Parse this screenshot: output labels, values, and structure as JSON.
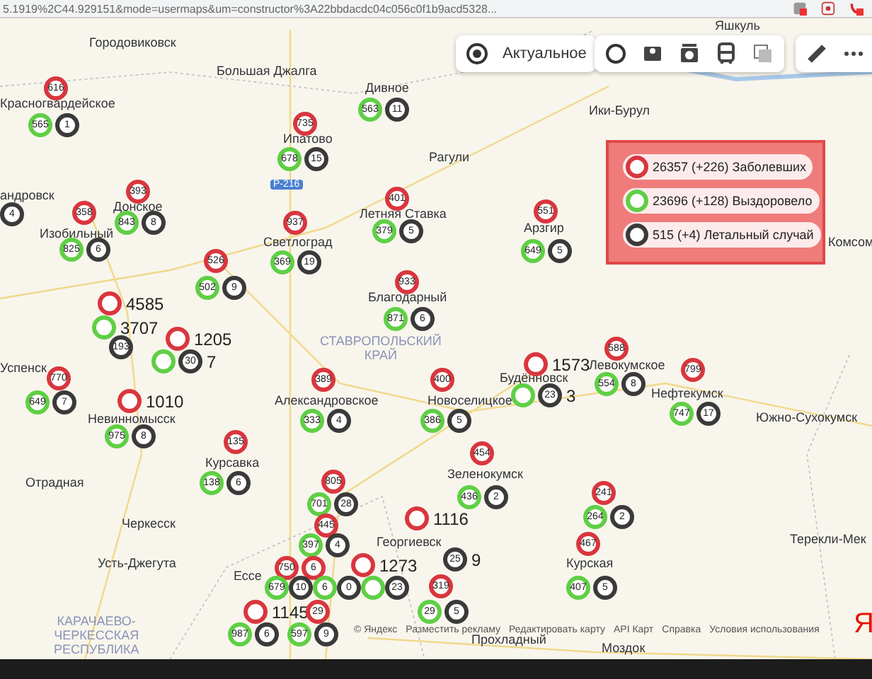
{
  "browser": {
    "url": "5.1919%2C44.929151&mode=usermaps&um=constructor%3A22bbdacdc04c056c0f1b9acd5328..."
  },
  "toolbar": {
    "layer_button": "Актуальное"
  },
  "legend": [
    {
      "kind": "infected",
      "text": "26357 (+226) Заболевших"
    },
    {
      "kind": "recovered",
      "text": "23696 (+128) Выздоровело"
    },
    {
      "kind": "deaths",
      "text": "515 (+4) Летальный случай"
    }
  ],
  "places": [
    {
      "kind": "town",
      "name": "Яшкуль"
    },
    {
      "kind": "town",
      "name": "Городовиковск"
    },
    {
      "kind": "town",
      "name": "Большая Джалга"
    },
    {
      "kind": "town",
      "name": "Красногвардейское"
    },
    {
      "kind": "town",
      "name": "Дивное"
    },
    {
      "kind": "town",
      "name": "Ипатово"
    },
    {
      "kind": "town",
      "name": "Ики-Бурул"
    },
    {
      "kind": "town",
      "name": "Рагули"
    },
    {
      "kind": "town",
      "name": "андровск"
    },
    {
      "kind": "town",
      "name": "Донское"
    },
    {
      "kind": "town",
      "name": "Летняя Ставка"
    },
    {
      "kind": "town",
      "name": "Изобильный"
    },
    {
      "kind": "town",
      "name": "Светлоград"
    },
    {
      "kind": "town",
      "name": "Арзгир"
    },
    {
      "kind": "town",
      "name": "Комсом"
    },
    {
      "kind": "town",
      "name": "Благодарный"
    },
    {
      "kind": "region",
      "name": "СТАВРОПОЛЬСКИЙ КРАЙ"
    },
    {
      "kind": "town",
      "name": "Успенск"
    },
    {
      "kind": "town",
      "name": "Будённовск"
    },
    {
      "kind": "town",
      "name": "Левокумское"
    },
    {
      "kind": "town",
      "name": "Нефтекумск"
    },
    {
      "kind": "town",
      "name": "Александровское"
    },
    {
      "kind": "town",
      "name": "Новоселицкое"
    },
    {
      "kind": "town",
      "name": "Невинномысск"
    },
    {
      "kind": "town",
      "name": "Южно-Сухокумск"
    },
    {
      "kind": "town",
      "name": "Курсавка"
    },
    {
      "kind": "town",
      "name": "Отрадная"
    },
    {
      "kind": "town",
      "name": "Зеленокумск"
    },
    {
      "kind": "town",
      "name": "Черкесск"
    },
    {
      "kind": "town",
      "name": "Георгиевск"
    },
    {
      "kind": "town",
      "name": "Терекли-Мек"
    },
    {
      "kind": "town",
      "name": "Усть-Джегута"
    },
    {
      "kind": "town",
      "name": "Курская"
    },
    {
      "kind": "town",
      "name": "Ессе"
    },
    {
      "kind": "region",
      "name": "КАРАЧАЕВО-ЧЕРКЕССКАЯ РЕСПУБЛИКА"
    },
    {
      "kind": "town",
      "name": "Прохладный"
    },
    {
      "kind": "town",
      "name": "Моздок"
    },
    {
      "kind": "road",
      "name": "Р-216"
    }
  ],
  "clusters": [
    {
      "markers": [
        {
          "kind": "infected",
          "value": "616"
        }
      ]
    },
    {
      "markers": [
        {
          "kind": "recovered",
          "value": "565"
        },
        {
          "kind": "deaths",
          "value": "1"
        }
      ]
    },
    {
      "markers": [
        {
          "kind": "infected",
          "value": "735"
        }
      ]
    },
    {
      "markers": [
        {
          "kind": "recovered",
          "value": "563"
        },
        {
          "kind": "deaths",
          "value": "11"
        }
      ]
    },
    {
      "markers": [
        {
          "kind": "recovered",
          "value": "678"
        },
        {
          "kind": "deaths",
          "value": "15"
        }
      ]
    },
    {
      "markers": [
        {
          "kind": "infected",
          "value": "393"
        }
      ]
    },
    {
      "markers": [
        {
          "kind": "infected",
          "value": "401"
        }
      ]
    },
    {
      "markers": [
        {
          "kind": "deaths",
          "value": "4"
        }
      ]
    },
    {
      "markers": [
        {
          "kind": "infected",
          "value": "358"
        }
      ]
    },
    {
      "markers": [
        {
          "kind": "recovered",
          "value": "843"
        },
        {
          "kind": "deaths",
          "value": "8"
        }
      ]
    },
    {
      "markers": [
        {
          "kind": "infected",
          "value": "937"
        }
      ]
    },
    {
      "markers": [
        {
          "kind": "recovered",
          "value": "379"
        },
        {
          "kind": "deaths",
          "value": "5"
        }
      ]
    },
    {
      "markers": [
        {
          "kind": "recovered",
          "value": "825"
        },
        {
          "kind": "deaths",
          "value": "6"
        }
      ]
    },
    {
      "markers": [
        {
          "kind": "infected",
          "value": "526"
        }
      ]
    },
    {
      "markers": [
        {
          "kind": "recovered",
          "value": "369"
        },
        {
          "kind": "deaths",
          "value": "19"
        }
      ]
    },
    {
      "markers": [
        {
          "kind": "recovered",
          "value": "502"
        },
        {
          "kind": "deaths",
          "value": "9"
        }
      ]
    },
    {
      "markers": [
        {
          "kind": "infected",
          "value": "933"
        }
      ]
    },
    {
      "markers": [
        {
          "kind": "recovered",
          "value": "871"
        },
        {
          "kind": "deaths",
          "value": "6"
        }
      ]
    },
    {
      "markers": [
        {
          "kind": "infected"
        }
      ],
      "label": "4585"
    },
    {
      "markers": [
        {
          "kind": "recovered"
        }
      ],
      "label": "3707"
    },
    {
      "markers": [
        {
          "kind": "deaths",
          "value": "193"
        }
      ]
    },
    {
      "markers": [
        {
          "kind": "infected"
        }
      ],
      "label": "1205"
    },
    {
      "markers": [
        {
          "kind": "recovered"
        },
        {
          "kind": "deaths",
          "value": "30"
        }
      ],
      "label": "7"
    },
    {
      "markers": [
        {
          "kind": "infected",
          "value": "770"
        }
      ]
    },
    {
      "markers": [
        {
          "kind": "recovered",
          "value": "649"
        },
        {
          "kind": "deaths",
          "value": "7"
        }
      ]
    },
    {
      "markers": [
        {
          "kind": "infected"
        }
      ],
      "label": "1010"
    },
    {
      "markers": [
        {
          "kind": "recovered",
          "value": "975"
        },
        {
          "kind": "deaths",
          "value": "8"
        }
      ]
    },
    {
      "markers": [
        {
          "kind": "infected",
          "value": "389"
        }
      ]
    },
    {
      "markers": [
        {
          "kind": "recovered",
          "value": "333"
        },
        {
          "kind": "deaths",
          "value": "4"
        }
      ]
    },
    {
      "markers": [
        {
          "kind": "infected",
          "value": "400"
        }
      ]
    },
    {
      "markers": [
        {
          "kind": "recovered",
          "value": "386"
        },
        {
          "kind": "deaths",
          "value": "5"
        }
      ]
    },
    {
      "markers": [
        {
          "kind": "infected",
          "value": "551"
        }
      ]
    },
    {
      "markers": [
        {
          "kind": "recovered",
          "value": "649"
        },
        {
          "kind": "deaths",
          "value": "5"
        }
      ]
    },
    {
      "markers": [
        {
          "kind": "infected"
        }
      ],
      "label": "1573"
    },
    {
      "markers": [
        {
          "kind": "recovered"
        },
        {
          "kind": "deaths",
          "value": "23"
        }
      ],
      "label": "3"
    },
    {
      "markers": [
        {
          "kind": "infected",
          "value": "588"
        }
      ]
    },
    {
      "markers": [
        {
          "kind": "recovered",
          "value": "554"
        },
        {
          "kind": "deaths",
          "value": "8"
        }
      ]
    },
    {
      "markers": [
        {
          "kind": "infected",
          "value": "799"
        }
      ]
    },
    {
      "markers": [
        {
          "kind": "recovered",
          "value": "747"
        },
        {
          "kind": "deaths",
          "value": "17"
        }
      ]
    },
    {
      "markers": [
        {
          "kind": "infected",
          "value": "135"
        }
      ]
    },
    {
      "markers": [
        {
          "kind": "recovered",
          "value": "138"
        },
        {
          "kind": "deaths",
          "value": "6"
        }
      ]
    },
    {
      "markers": [
        {
          "kind": "infected",
          "value": "805"
        }
      ]
    },
    {
      "markers": [
        {
          "kind": "recovered",
          "value": "701"
        },
        {
          "kind": "deaths",
          "value": "28"
        }
      ]
    },
    {
      "markers": [
        {
          "kind": "infected",
          "value": "454"
        }
      ]
    },
    {
      "markers": [
        {
          "kind": "recovered",
          "value": "436"
        },
        {
          "kind": "deaths",
          "value": "2"
        }
      ]
    },
    {
      "markers": [
        {
          "kind": "infected",
          "value": "445"
        }
      ]
    },
    {
      "markers": [
        {
          "kind": "recovered",
          "value": "397"
        },
        {
          "kind": "deaths",
          "value": "4"
        }
      ]
    },
    {
      "markers": [
        {
          "kind": "infected",
          "value": "750"
        },
        {
          "kind": "infected",
          "value": "6"
        }
      ]
    },
    {
      "markers": [
        {
          "kind": "infected"
        }
      ],
      "label": "1273"
    },
    {
      "markers": [
        {
          "kind": "recovered",
          "value": "679"
        },
        {
          "kind": "deaths",
          "value": "10"
        },
        {
          "kind": "recovered",
          "value": "6"
        },
        {
          "kind": "deaths",
          "value": "0"
        },
        {
          "kind": "recovered"
        },
        {
          "kind": "deaths",
          "value": "23"
        }
      ]
    },
    {
      "markers": [
        {
          "kind": "infected"
        }
      ],
      "label": "1116"
    },
    {
      "markers": [
        {
          "kind": "deaths",
          "value": "25"
        }
      ],
      "label": "9"
    },
    {
      "markers": [
        {
          "kind": "infected",
          "value": "319"
        }
      ]
    },
    {
      "markers": [
        {
          "kind": "infected"
        }
      ],
      "label": "1145"
    },
    {
      "markers": [
        {
          "kind": "infected",
          "value": "29"
        }
      ]
    },
    {
      "markers": [
        {
          "kind": "recovered",
          "value": "29"
        },
        {
          "kind": "deaths",
          "value": "5"
        }
      ]
    },
    {
      "markers": [
        {
          "kind": "recovered",
          "value": "987"
        },
        {
          "kind": "deaths",
          "value": "6"
        }
      ]
    },
    {
      "markers": [
        {
          "kind": "recovered",
          "value": "597"
        },
        {
          "kind": "deaths",
          "value": "9"
        }
      ]
    },
    {
      "markers": [
        {
          "kind": "infected",
          "value": "241"
        }
      ]
    },
    {
      "markers": [
        {
          "kind": "recovered",
          "value": "264"
        },
        {
          "kind": "deaths",
          "value": "2"
        }
      ]
    },
    {
      "markers": [
        {
          "kind": "infected",
          "value": "467"
        }
      ]
    },
    {
      "markers": [
        {
          "kind": "recovered",
          "value": "407"
        },
        {
          "kind": "deaths",
          "value": "5"
        }
      ]
    }
  ],
  "footer": {
    "copyright": "© Яндекс",
    "links": [
      "Разместить рекламу",
      "Редактировать карту",
      "API Карт",
      "Справка",
      "Условия использования"
    ],
    "logo": "Я"
  }
}
